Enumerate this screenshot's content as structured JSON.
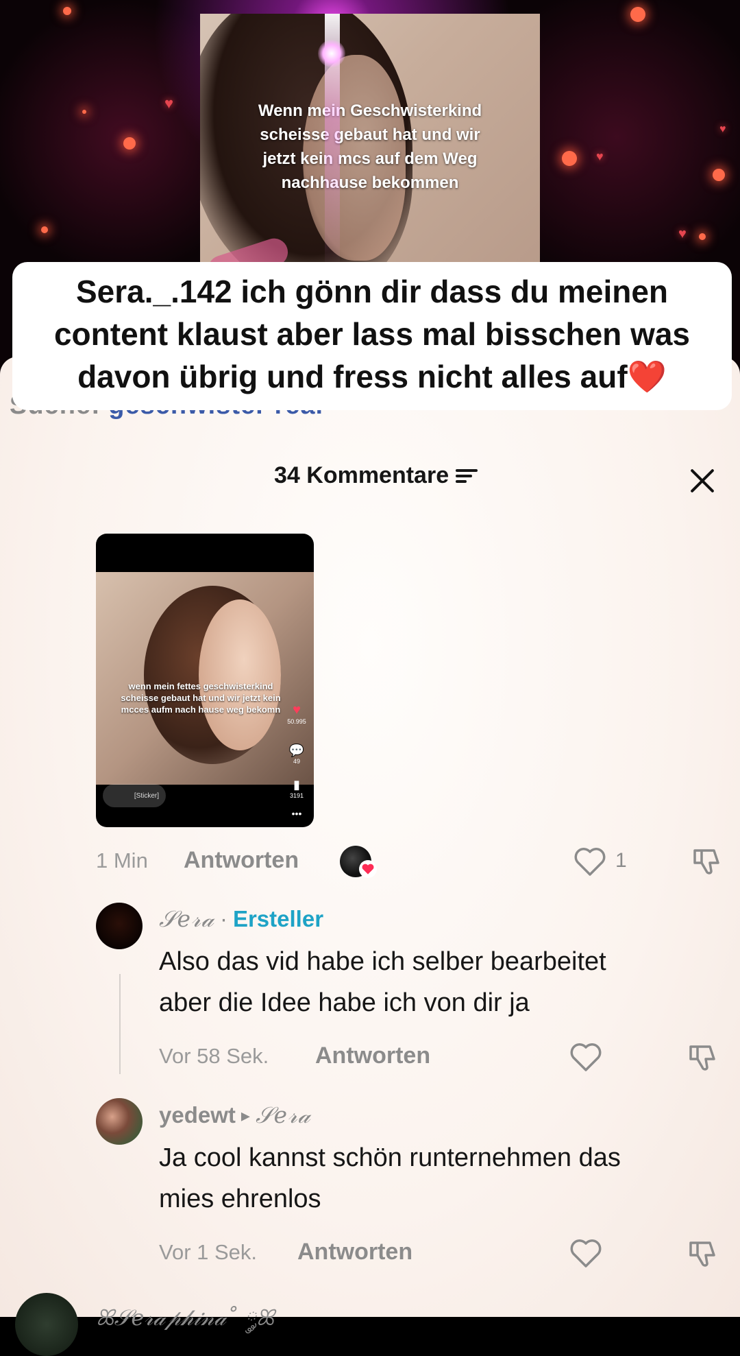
{
  "video": {
    "overlay_text_lines": [
      "Wenn mein Geschwisterkind",
      "scheisse gebaut hat und wir",
      "jetzt kein mcs auf dem Weg",
      "nachhause bekommen"
    ]
  },
  "reply_banner": {
    "lines": [
      "Sera._.142 ich gönn dir dass du meinen",
      "content klaust aber lass mal bisschen was",
      "davon übrig und fress nicht alles auf❤️"
    ]
  },
  "search_hint": {
    "label": "Suche:",
    "term": "geschwister real"
  },
  "comments_header": {
    "title": "34 Kommentare"
  },
  "sticker_comment": {
    "sticker": {
      "overlay_lines": [
        "wenn mein fettes geschwisterkind",
        "scheisse gebaut hat und wir jetzt kein",
        "mcces aufm nach hause weg bekomn"
      ],
      "likes": "50.995",
      "comments": "49",
      "saves": "3191",
      "chip": "[Sticker]"
    },
    "time": "1 Min",
    "reply_label": "Antworten",
    "like_count": "1"
  },
  "replies": [
    {
      "username": "𝒮𝑒𝓇𝒶",
      "separator": "·",
      "badge": "Ersteller",
      "text_lines": [
        "Also das vid habe ich selber bearbeitet",
        "aber die Idee habe ich von dir ja"
      ],
      "time": "Vor 58 Sek.",
      "reply_label": "Antworten"
    },
    {
      "username": "yedewt",
      "arrow": "▸",
      "reply_to": "𝒮𝑒𝓇𝒶",
      "text_lines": [
        "Ja cool kannst schön runternehmen das",
        "mies ehrenlos"
      ],
      "time": "Vor 1 Sek.",
      "reply_label": "Antworten"
    }
  ],
  "next_comment": {
    "username": "ꕤ𝒮𝑒𝓇𝒶𝓅𝒽𝒾𝓃𝒶˚ ༘ꕤ"
  },
  "icons": {
    "close": "close-icon",
    "sort": "sort-icon",
    "like": "heart-outline-icon",
    "dislike": "thumbs-down-icon"
  },
  "colors": {
    "accent": "#1ea3c6",
    "text": "#161616",
    "muted": "#8b8b8b",
    "panel": "#fbf3ee"
  }
}
